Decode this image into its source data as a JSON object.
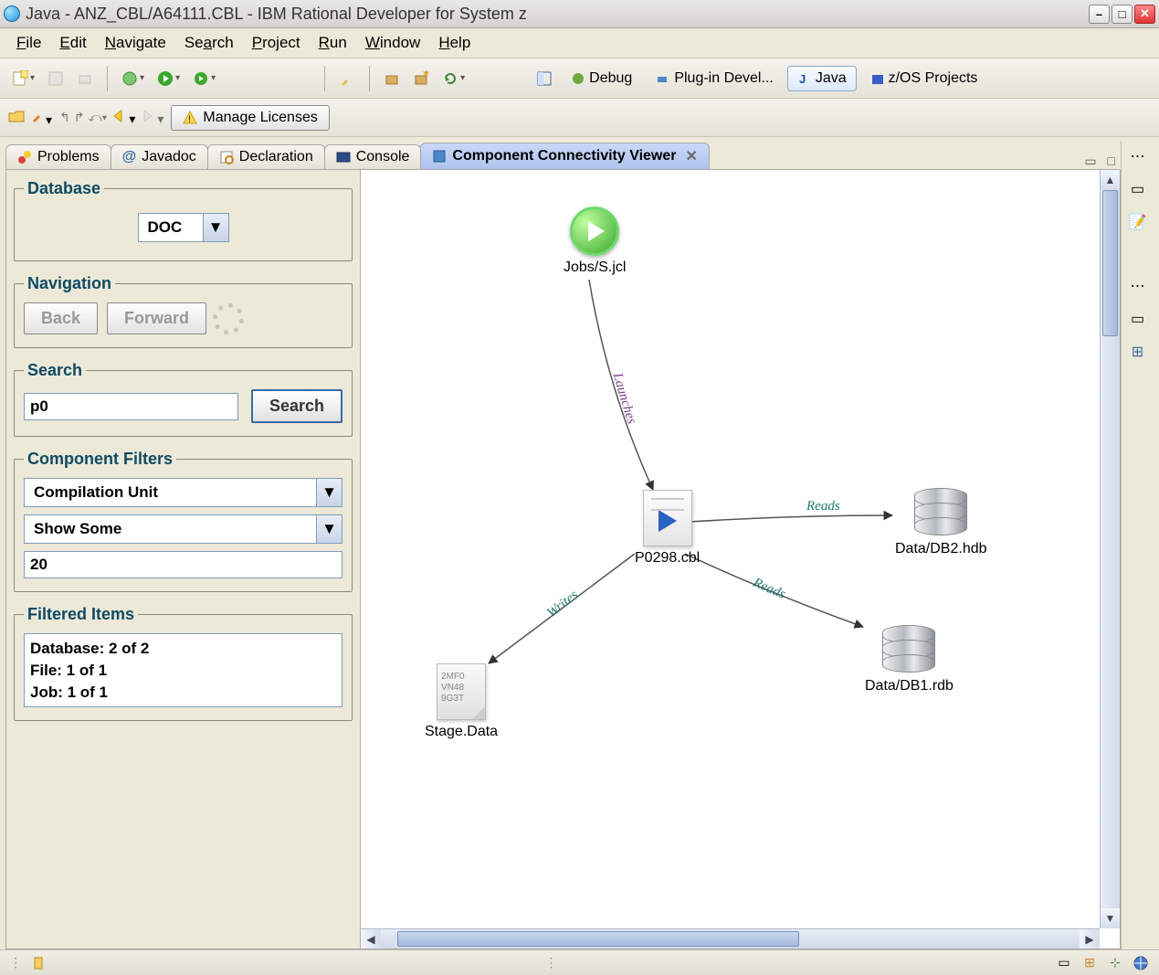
{
  "window": {
    "title": "Java - ANZ_CBL/A64111.CBL - IBM Rational Developer for System z"
  },
  "menu": {
    "file": "File",
    "edit": "Edit",
    "navigate": "Navigate",
    "search": "Search",
    "project": "Project",
    "run": "Run",
    "window": "Window",
    "help": "Help"
  },
  "toolbar": {
    "manage_licenses": "Manage Licenses"
  },
  "perspectives": {
    "debug": "Debug",
    "plugin": "Plug-in Devel...",
    "java": "Java",
    "zos": "z/OS Projects"
  },
  "tabs": {
    "problems": "Problems",
    "javadoc": "Javadoc",
    "declaration": "Declaration",
    "console": "Console",
    "component_viewer": "Component Connectivity Viewer"
  },
  "panel": {
    "database": {
      "legend": "Database",
      "value": "DOC"
    },
    "navigation": {
      "legend": "Navigation",
      "back": "Back",
      "forward": "Forward"
    },
    "search": {
      "legend": "Search",
      "value": "p0",
      "button": "Search"
    },
    "filters": {
      "legend": "Component Filters",
      "type": "Compilation Unit",
      "show": "Show Some",
      "count": "20"
    },
    "filtered": {
      "legend": "Filtered Items",
      "line1": "Database: 2 of 2",
      "line2": "File: 1 of 1",
      "line3": "Job: 1 of 1"
    }
  },
  "graph": {
    "nodes": {
      "job": "Jobs/S.jcl",
      "program": "P0298.cbl",
      "db2": "Data/DB2.hdb",
      "db1": "Data/DB1.rdb",
      "stage": "Stage.Data"
    },
    "edges": {
      "launches": "Launches",
      "reads": "Reads",
      "writes": "Writes"
    },
    "file_preview": "2MF0\nVN48\n9G3T"
  }
}
